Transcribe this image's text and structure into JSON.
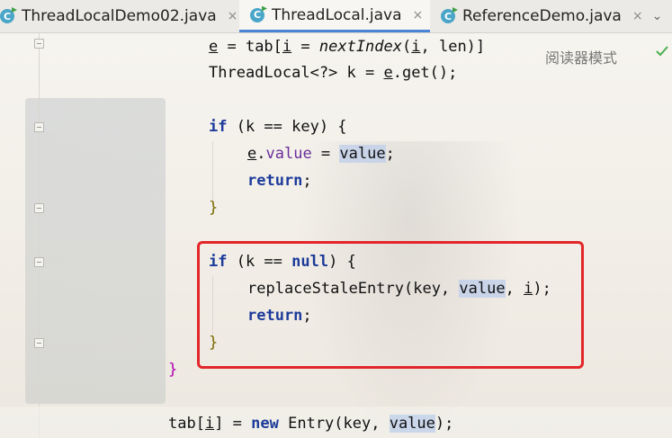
{
  "tabs": [
    {
      "label": "ThreadLocalDemo02.java",
      "active": false,
      "file_icon": "java-class-icon"
    },
    {
      "label": "ThreadLocal.java",
      "active": true,
      "file_icon": "java-class-icon"
    },
    {
      "label": "ReferenceDemo.java",
      "active": false,
      "file_icon": "java-class-icon"
    }
  ],
  "tab_close": "×",
  "tab_dropdown": "⌄",
  "reader_mode": "阅读器模式",
  "code": {
    "l1": {
      "a": "e",
      "b": " = tab[",
      "c": "i",
      "d": " = ",
      "e": "nextIndex",
      "f": "(",
      "g": "i",
      "h": ", len)]"
    },
    "l2": {
      "a": "ThreadLocal<?> k = ",
      "b": "e",
      "c": ".get();"
    },
    "l3": {
      "a": "if",
      "b": " (k == key) {"
    },
    "l4": {
      "a": "e",
      "b": ".",
      "c": "value",
      "d": " = ",
      "e": "value",
      "f": ";"
    },
    "l5": {
      "a": "return",
      "b": ";"
    },
    "l6": {
      "a": "}"
    },
    "l7": {
      "a": "if",
      "b": " (k == ",
      "c": "null",
      "d": ") {"
    },
    "l8": {
      "a": "replaceStaleEntry(key, ",
      "b": "value",
      "c": ", ",
      "d": "i",
      "e": ");"
    },
    "l9": {
      "a": "return",
      "b": ";"
    },
    "l10": {
      "a": "}"
    },
    "l11": {
      "a": "}"
    },
    "l12": {
      "a": "tab[",
      "b": "i",
      "c": "] = ",
      "d": "new",
      "e": " Entry(key, ",
      "f": "value",
      "g": ");"
    }
  },
  "colors": {
    "keyword": "#1d3b9a",
    "field": "#6a2d9a",
    "annotation_box": "#e3262a",
    "active_tab_underline": "#4a84d6"
  }
}
